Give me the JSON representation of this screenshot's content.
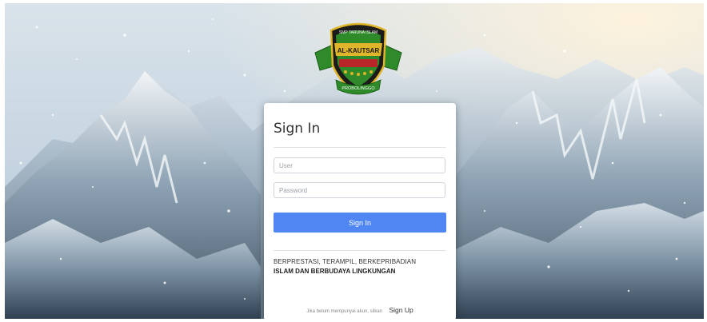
{
  "logo": {
    "top_text": "SMP TARUNA ISLAM",
    "emblem_text": "AL-KAUTSAR",
    "bottom_text": "PROBOLINGGO"
  },
  "login": {
    "title": "Sign In",
    "user_placeholder": "User",
    "password_placeholder": "Password",
    "submit_label": "Sign In",
    "tagline_line1": "BERPRESTASI, TERAMPIL, BERKEPRIBADIAN",
    "tagline_line2": "ISLAM DAN BERBUDAYA LINGKUNGAN",
    "signup_hint": "Jika belum mempunyai akun, silkan",
    "signup_link": "Sign Up"
  },
  "colors": {
    "primary_button": "#4f86f1",
    "card_background": "#ffffff",
    "emblem_green": "#2f8a2a",
    "emblem_gold": "#e0b52a",
    "emblem_red": "#b8262a"
  }
}
